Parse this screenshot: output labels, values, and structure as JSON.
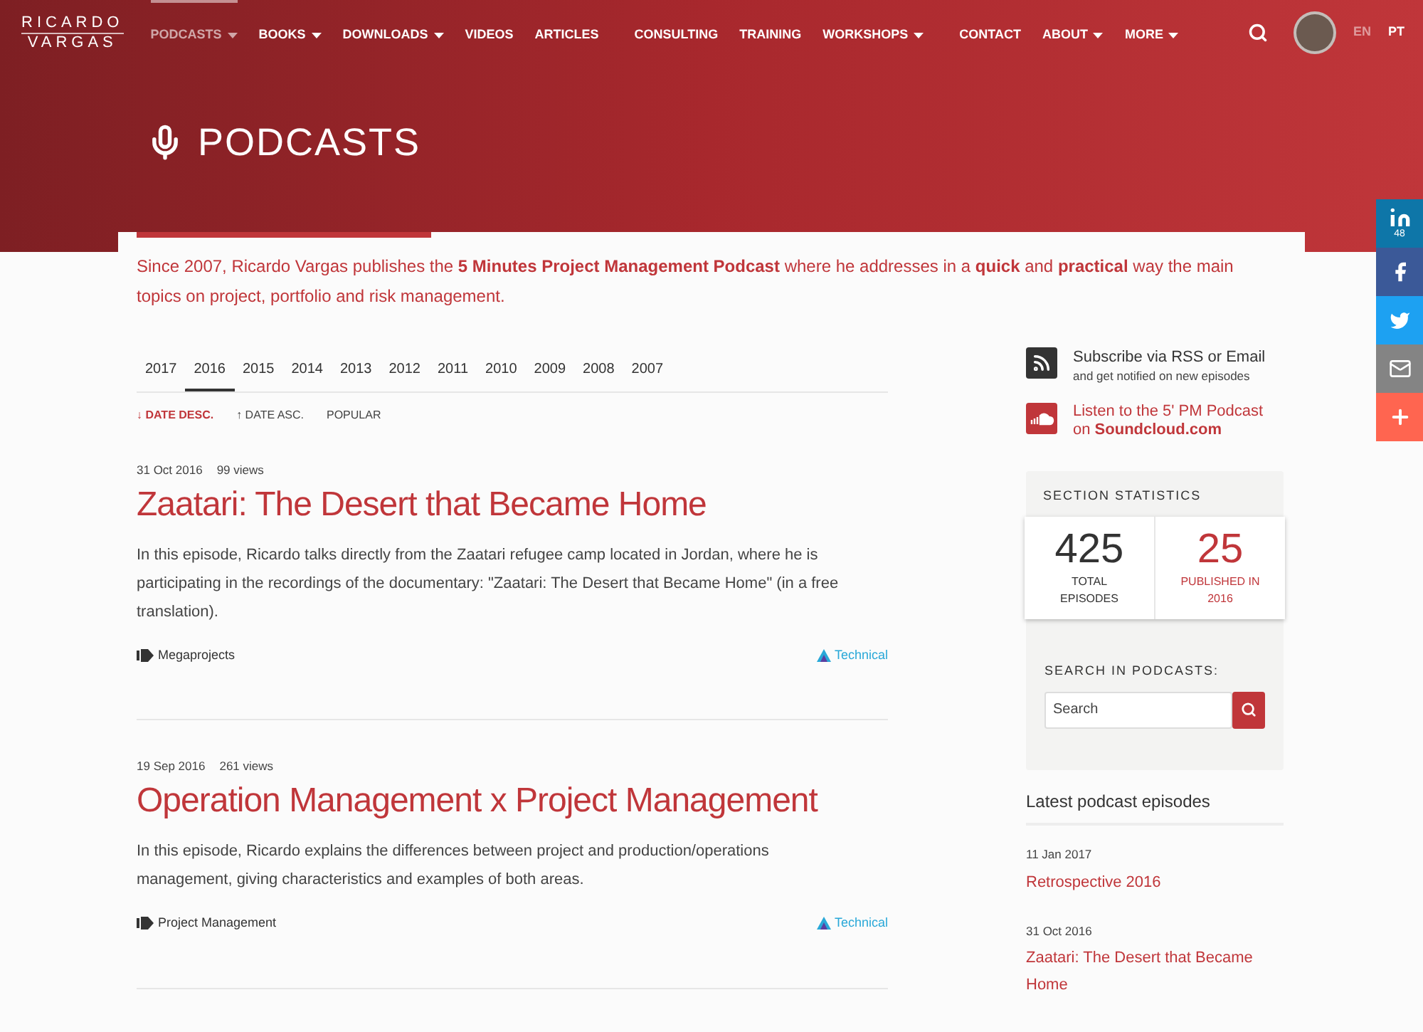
{
  "logo": {
    "line1": "RICARDO",
    "line2": "VARGAS"
  },
  "nav": [
    {
      "label": "PODCASTS",
      "dropdown": true,
      "selected": true
    },
    {
      "label": "BOOKS",
      "dropdown": true,
      "selected": false
    },
    {
      "label": "DOWNLOADS",
      "dropdown": true,
      "selected": false
    },
    {
      "label": "VIDEOS",
      "dropdown": false,
      "selected": false
    },
    {
      "label": "ARTICLES",
      "dropdown": false,
      "selected": false
    },
    {
      "label": "CONSULTING",
      "dropdown": false,
      "selected": false
    },
    {
      "label": "TRAINING",
      "dropdown": false,
      "selected": false
    },
    {
      "label": "WORKSHOPS",
      "dropdown": true,
      "selected": false
    },
    {
      "label": "CONTACT",
      "dropdown": false,
      "selected": false
    },
    {
      "label": "ABOUT",
      "dropdown": true,
      "selected": false
    },
    {
      "label": "MORE",
      "dropdown": true,
      "selected": false
    }
  ],
  "languages": [
    {
      "label": "EN",
      "selected": false
    },
    {
      "label": "PT",
      "selected": true
    }
  ],
  "page_title": "PODCASTS",
  "intro": "Since 2007, Ricardo Vargas publishes the **5 Minutes Project Management Podcast** where he addresses in a **quick** and **practical** way the main topics on project, portfolio and risk management.",
  "year_tabs": [
    {
      "label": "2017",
      "selected": false
    },
    {
      "label": "2016",
      "selected": true
    },
    {
      "label": "2015",
      "selected": false
    },
    {
      "label": "2014",
      "selected": false
    },
    {
      "label": "2013",
      "selected": false
    },
    {
      "label": "2012",
      "selected": false
    },
    {
      "label": "2011",
      "selected": false
    },
    {
      "label": "2010",
      "selected": false
    },
    {
      "label": "2009",
      "selected": false
    },
    {
      "label": "2008",
      "selected": false
    },
    {
      "label": "2007",
      "selected": false
    }
  ],
  "sort_options": [
    {
      "label": "↓ DATE DESC.",
      "selected": true
    },
    {
      "label": "↑ DATE ASC.",
      "selected": false
    },
    {
      "label": "POPULAR",
      "selected": false
    }
  ],
  "episodes": [
    {
      "date": "31 Oct 2016",
      "views": "99 views",
      "title": "Zaatari: The Desert that Became Home",
      "summary": "In this episode, Ricardo talks directly from the Zaatari refugee camp located in Jordan, where he is participating in the recordings of the documentary: \"Zaatari: The Desert that Became Home\" (in a free translation).",
      "tag": "Megaprojects",
      "level": "Technical"
    },
    {
      "date": "19 Sep 2016",
      "views": "261 views",
      "title": "Operation Management x Project Management",
      "summary": "In this episode, Ricardo explains the differences between project and production/operations management, giving characteristics and examples of both areas.",
      "tag": "Project Management",
      "level": "Technical"
    }
  ],
  "subscribe": {
    "title": "Subscribe via RSS or Email",
    "subtitle": "and get notified on new episodes"
  },
  "soundcloud": "Listen to the 5' PM Podcast on **Soundcloud.com**",
  "statistics": {
    "heading": "SECTION STATISTICS",
    "items": [
      {
        "kind": "total",
        "value": "425",
        "label": "TOTAL EPISODES"
      },
      {
        "kind": "highlight",
        "value": "25",
        "label": "PUBLISHED IN 2016"
      }
    ]
  },
  "search": {
    "heading": "SEARCH IN PODCASTS:",
    "placeholder": "Search"
  },
  "latest": {
    "heading": "Latest podcast episodes",
    "items": [
      {
        "date": "11 Jan 2017",
        "title": "Retrospective 2016"
      },
      {
        "date": "31 Oct 2016",
        "title": "Zaatari: The Desert that Became Home"
      }
    ]
  },
  "social": [
    {
      "kind": "linkedin",
      "count": "48",
      "color": "#0e76a8"
    },
    {
      "kind": "facebook",
      "color": "#3b5998"
    },
    {
      "kind": "twitter",
      "color": "#1da1f2"
    },
    {
      "kind": "email",
      "color": "#848484"
    },
    {
      "kind": "more",
      "color": "#ff6550"
    }
  ]
}
